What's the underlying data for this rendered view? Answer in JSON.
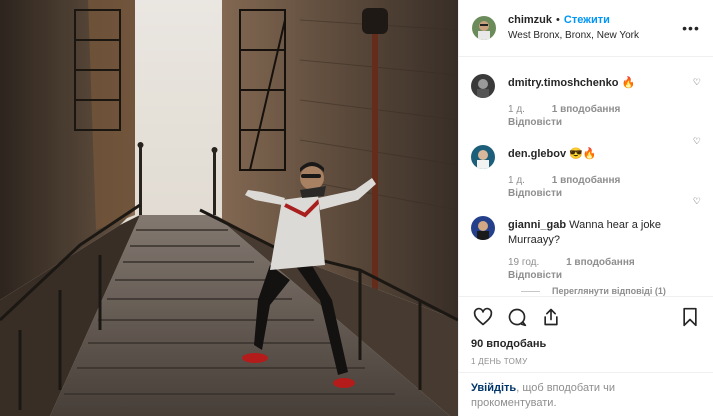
{
  "post": {
    "author": {
      "username": "chimzuk",
      "dot": "•",
      "follow_label": "Стежити",
      "location": "West Bronx, Bronx, New York",
      "more_label": "•••"
    },
    "comments": [
      {
        "username": "dmitry.timoshchenko",
        "text": "🔥",
        "time": "1 д.",
        "likes": "1 вподобання",
        "reply": "Відповісти",
        "avatar_color": "#3a3a3a"
      },
      {
        "username": "den.glebov",
        "text": "😎🔥",
        "time": "1 д.",
        "likes": "1 вподобання",
        "reply": "Відповісти",
        "avatar_color": "#1d5f7a"
      },
      {
        "username": "gianni_gab",
        "text": "Wanna hear a joke Murraayy?",
        "time": "19 год.",
        "likes": "1 вподобання",
        "reply": "Відповісти",
        "avatar_color": "#24408a",
        "view_replies": "Переглянути відповіді (1)"
      }
    ],
    "heart_small": "♡",
    "likes_count": "90 вподобань",
    "time_ago": "1 ДЕНЬ ТОМУ",
    "login": {
      "link": "Увійдіть",
      "rest": ", щоб вподобати чи прокоментувати."
    },
    "icons": [
      "heart-icon",
      "comment-icon",
      "share-icon",
      "bookmark-icon"
    ],
    "colors": {
      "link_blue": "#0095f6",
      "secondary_text": "#8e8e8e",
      "login_link": "#00376b"
    }
  }
}
